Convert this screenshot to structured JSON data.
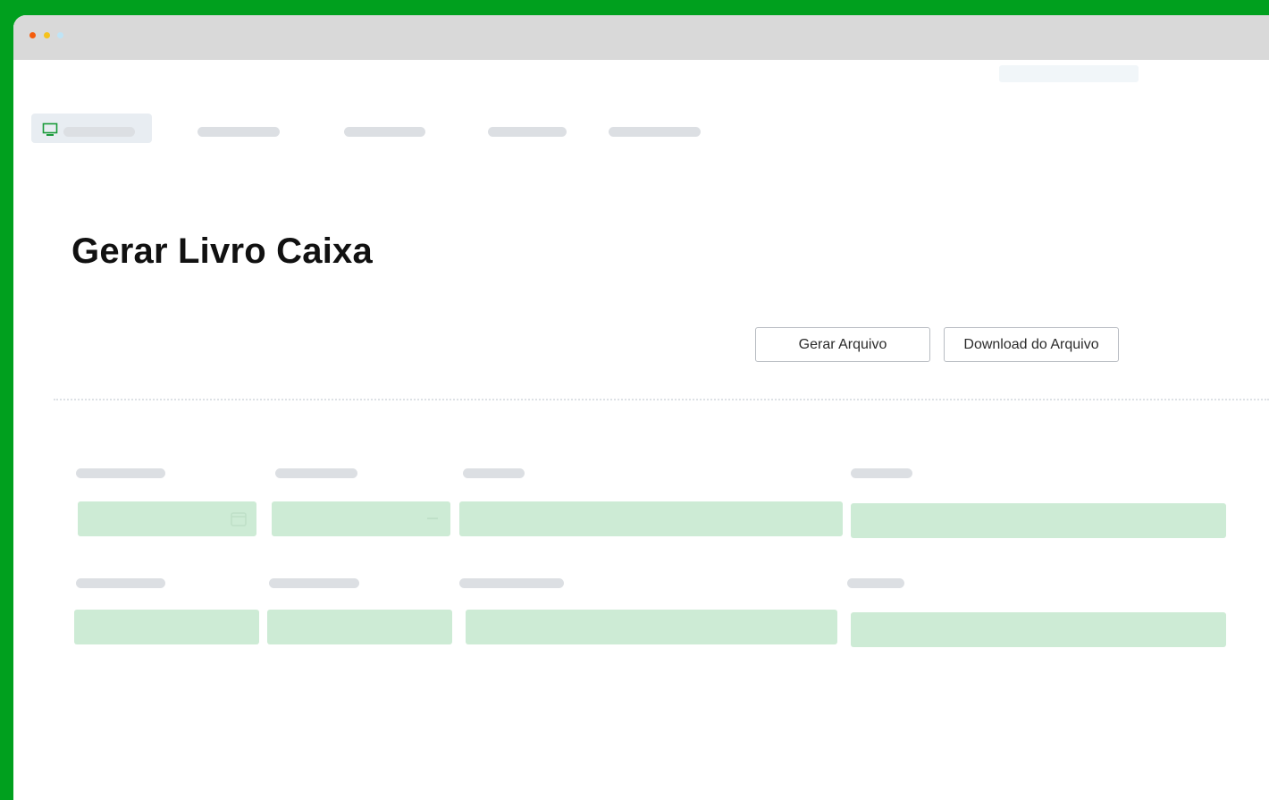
{
  "window": {
    "controls": [
      {
        "name": "close-dot",
        "color": "#f45c0c"
      },
      {
        "name": "minimize-dot",
        "color": "#f6c21b"
      },
      {
        "name": "maximize-dot",
        "color": "#bfe4f6"
      }
    ]
  },
  "nav": {
    "active_icon": "monitor-icon",
    "accent_color": "#1a9b3a"
  },
  "page": {
    "title": "Gerar Livro Caixa"
  },
  "actions": {
    "generate_label": "Gerar Arquivo",
    "download_label": "Download do Arquivo"
  },
  "form": {
    "field_color": "#cdebd5",
    "date_icon": "calendar-icon",
    "select_icon": "dash-icon"
  }
}
